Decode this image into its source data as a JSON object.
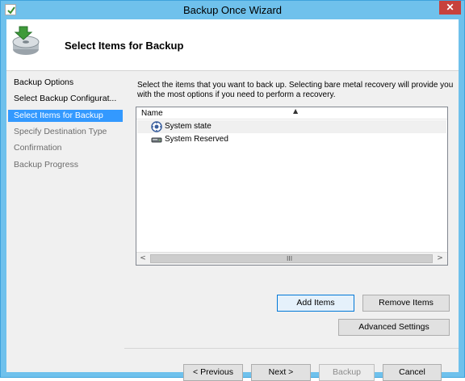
{
  "window": {
    "title": "Backup Once Wizard",
    "close_glyph": "✕"
  },
  "header": {
    "title": "Select Items for Backup",
    "icon": "backup-disk-icon"
  },
  "steps": [
    {
      "label": "Backup Options",
      "state": "done"
    },
    {
      "label": "Select Backup Configurat...",
      "state": "done"
    },
    {
      "label": "Select Items for Backup",
      "state": "active"
    },
    {
      "label": "Specify Destination Type",
      "state": "pending"
    },
    {
      "label": "Confirmation",
      "state": "pending"
    },
    {
      "label": "Backup Progress",
      "state": "pending"
    }
  ],
  "content": {
    "instructions": "Select the items that you want to back up. Selecting bare metal recovery will provide you with the most options if you need to perform a recovery.",
    "list": {
      "column": "Name",
      "items": [
        {
          "label": "System state",
          "icon": "system-state-icon"
        },
        {
          "label": "System Reserved",
          "icon": "drive-icon"
        }
      ],
      "scroll_left": "<",
      "scroll_right": ">",
      "grip": "III"
    },
    "buttons": {
      "add_items": "Add Items",
      "remove_items": "Remove Items",
      "advanced_settings": "Advanced Settings"
    }
  },
  "nav": {
    "previous": "< Previous",
    "next": "Next >",
    "backup": "Backup",
    "cancel": "Cancel"
  },
  "colors": {
    "titlebar": "#6fc1ec",
    "active_step": "#3399ff",
    "close_button": "#c7423d"
  }
}
